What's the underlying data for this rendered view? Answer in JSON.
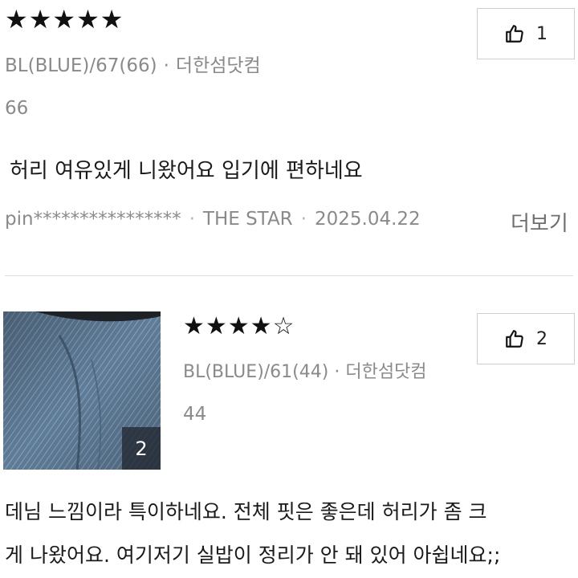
{
  "review1": {
    "rating": 5,
    "stars": "★★★★★",
    "option": "BL(BLUE)/67(66)",
    "store": "더한섬닷컴",
    "size_value": "66",
    "text": "허리 여유있게 니왔어요 입기에 편하네요",
    "user": "pin****************",
    "brand": "THE STAR",
    "date": "2025.04.22",
    "more_label": "더보기",
    "like_count": "1"
  },
  "review2": {
    "rating": 4,
    "stars": "★★★★☆",
    "option": "BL(BLUE)/61(44)",
    "store": "더한섬닷컴",
    "size_value": "44",
    "photo_count": "2",
    "text_line1": "데님 느낌이라 특이하네요. 전체 핏은 좋은데 허리가 좀 크",
    "text_line2": "게 나왔어요. 여기저기 실밥이 정리가 안 돼 있어 아쉽네요;;",
    "like_count": "2"
  },
  "colors": {
    "star": "#111111",
    "meta_gray": "#8a8a8a",
    "denim": "#5f7c98"
  },
  "icons": [
    "star-icon",
    "thumbs-up-icon"
  ]
}
